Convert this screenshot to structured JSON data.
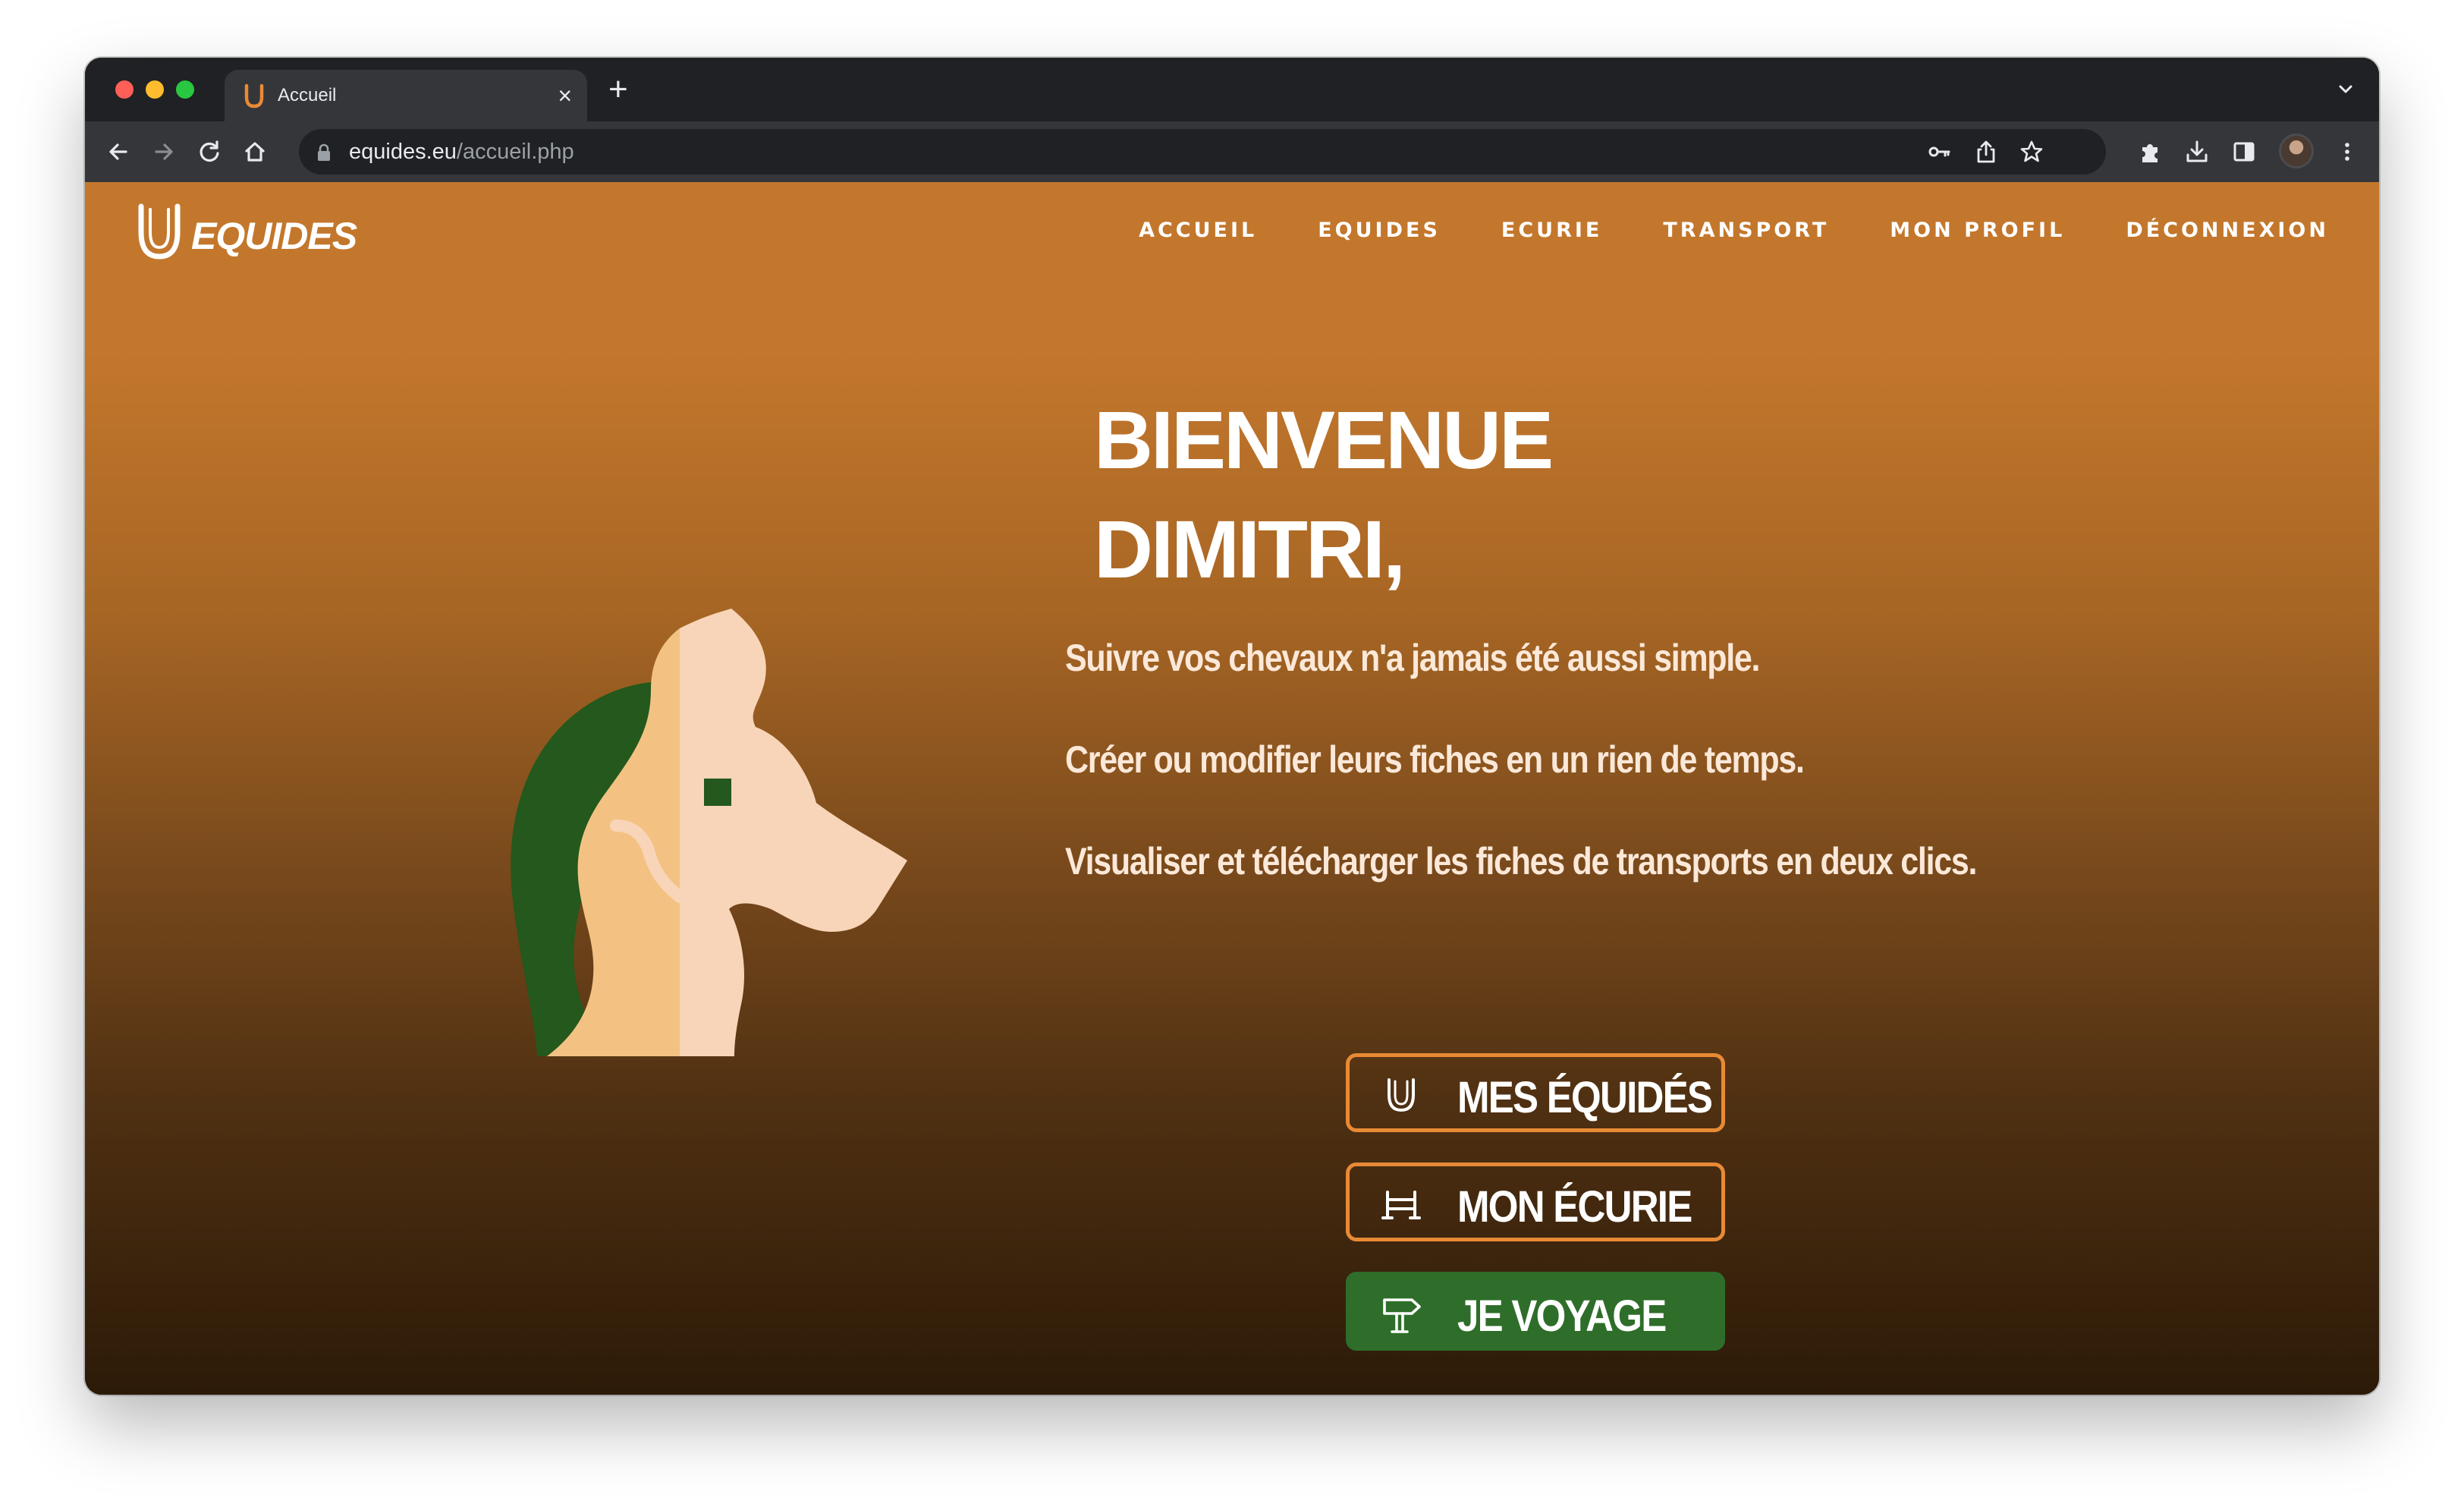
{
  "browser": {
    "tab_title": "Accueil",
    "tab_close_symbol": "×",
    "new_tab_symbol": "+",
    "url_host": "equides.eu",
    "url_path": "/accueil.php"
  },
  "site": {
    "logo_text": "EQUIDES",
    "nav": [
      "ACCUEIL",
      "EQUIDES",
      "ECURIE",
      "TRANSPORT",
      "MON PROFIL",
      "DÉCONNEXION"
    ]
  },
  "hero": {
    "title_line1": "BIENVENUE",
    "title_line2": "DIMITRI,",
    "lines": [
      "Suivre vos chevaux n'a jamais été aussi simple.",
      "Créer ou modifier leurs fiches en un rien de temps.",
      "Visualiser et télécharger les fiches de transports en deux clics."
    ]
  },
  "actions": [
    {
      "label": "MES ÉQUIDÉS",
      "icon": "horseshoe-icon"
    },
    {
      "label": "MON ÉCURIE",
      "icon": "fence-icon"
    },
    {
      "label": "JE VOYAGE",
      "icon": "signpost-icon"
    }
  ],
  "colors": {
    "accent_orange": "#e88a35",
    "header_orange": "#c3772c",
    "green": "#2e6e2a",
    "horse_light": "#f8d5b8",
    "horse_mid": "#f3c283",
    "mane": "#24581c"
  }
}
